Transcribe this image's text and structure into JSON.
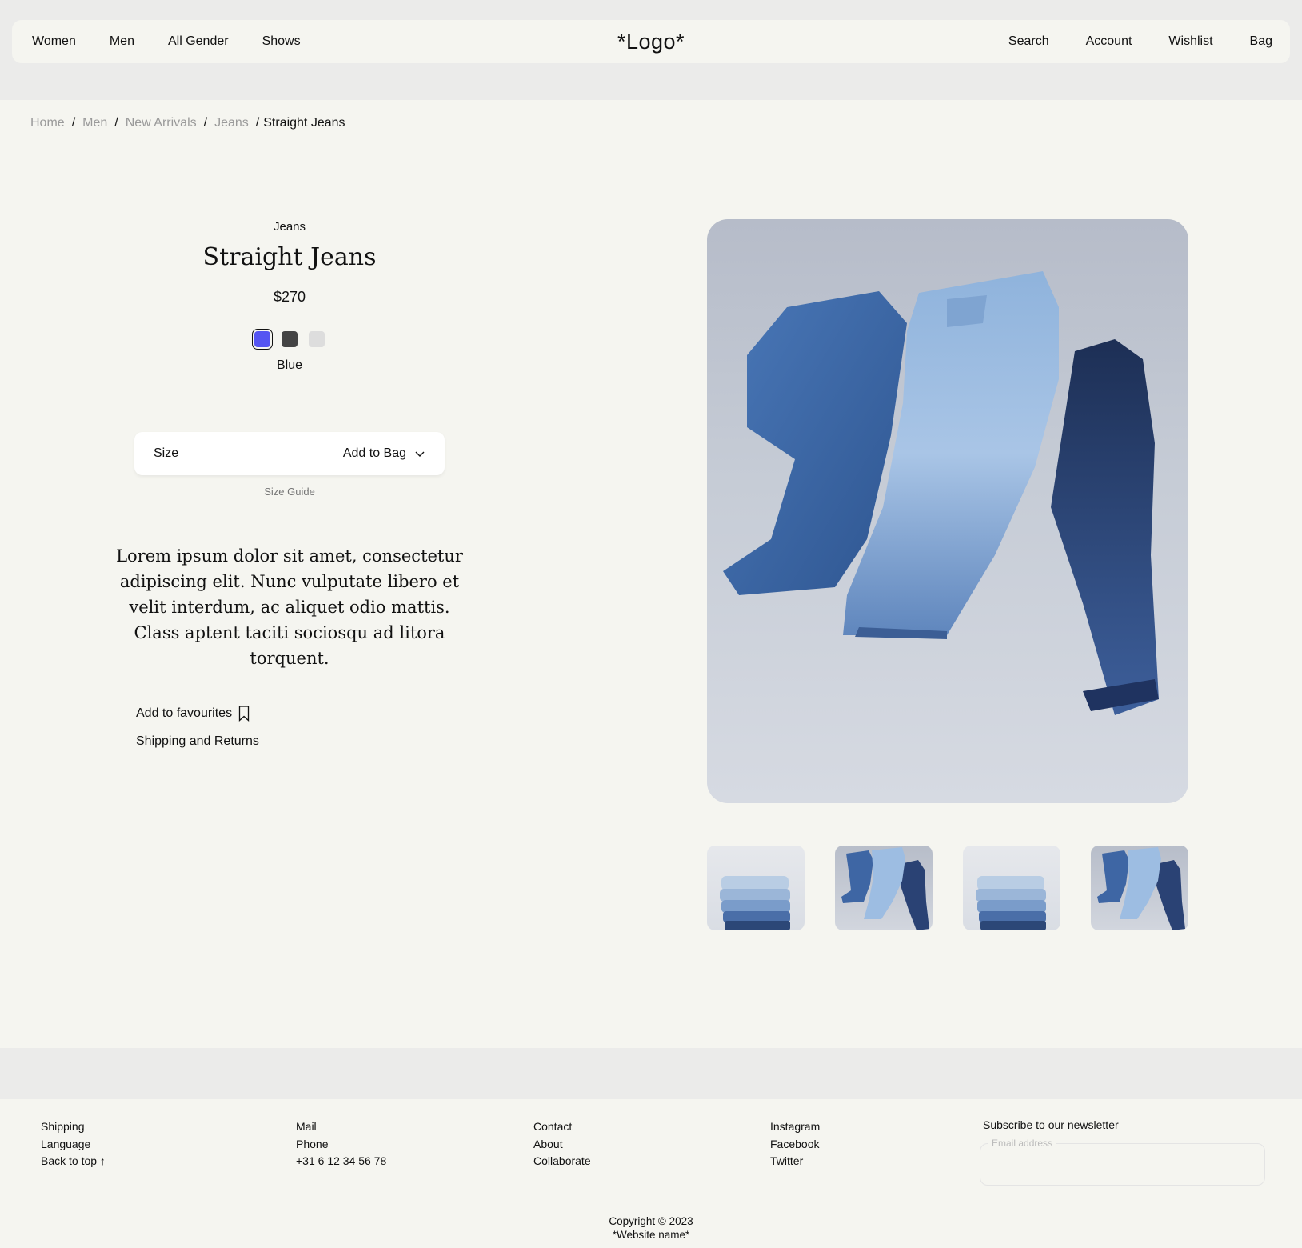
{
  "nav": {
    "left": [
      "Women",
      "Men",
      "All Gender",
      "Shows"
    ],
    "logo": "*Logo*",
    "right": [
      "Search",
      "Account",
      "Wishlist",
      "Bag"
    ]
  },
  "breadcrumb": {
    "items": [
      "Home",
      "Men",
      "New Arrivals",
      "Jeans"
    ],
    "separator": "/",
    "current": "Straight Jeans"
  },
  "product": {
    "category": "Jeans",
    "title": "Straight Jeans",
    "price": "$270",
    "swatches": [
      {
        "color": "#5555f2",
        "name": "Blue",
        "selected": true
      },
      {
        "color": "#444444",
        "name": "Black",
        "selected": false
      },
      {
        "color": "#dddddd",
        "name": "Light Grey",
        "selected": false
      }
    ],
    "selected_color": "Blue",
    "size_label": "Size",
    "add_to_bag": "Add to Bag",
    "size_guide": "Size Guide",
    "description": "Lorem ipsum dolor sit amet, consectetur adipiscing elit. Nunc vulputate libero et velit interdum, ac aliquet odio mattis. Class aptent taciti sociosqu ad litora torquent.",
    "add_to_favourites": "Add to favourites",
    "shipping_returns": "Shipping and Returns"
  },
  "footer": {
    "col1": [
      "Shipping",
      "Language",
      "Back to top ↑"
    ],
    "col2": [
      "Mail",
      "Phone",
      "+31 6 12 34 56 78"
    ],
    "col3": [
      "Contact",
      "About",
      "Collaborate"
    ],
    "col4": [
      "Instagram",
      "Facebook",
      "Twitter"
    ],
    "newsletter_title": "Subscribe to our newsletter",
    "email_placeholder": "Email address",
    "copyright": "Copyright © 2023",
    "website_name": "*Website name*"
  }
}
